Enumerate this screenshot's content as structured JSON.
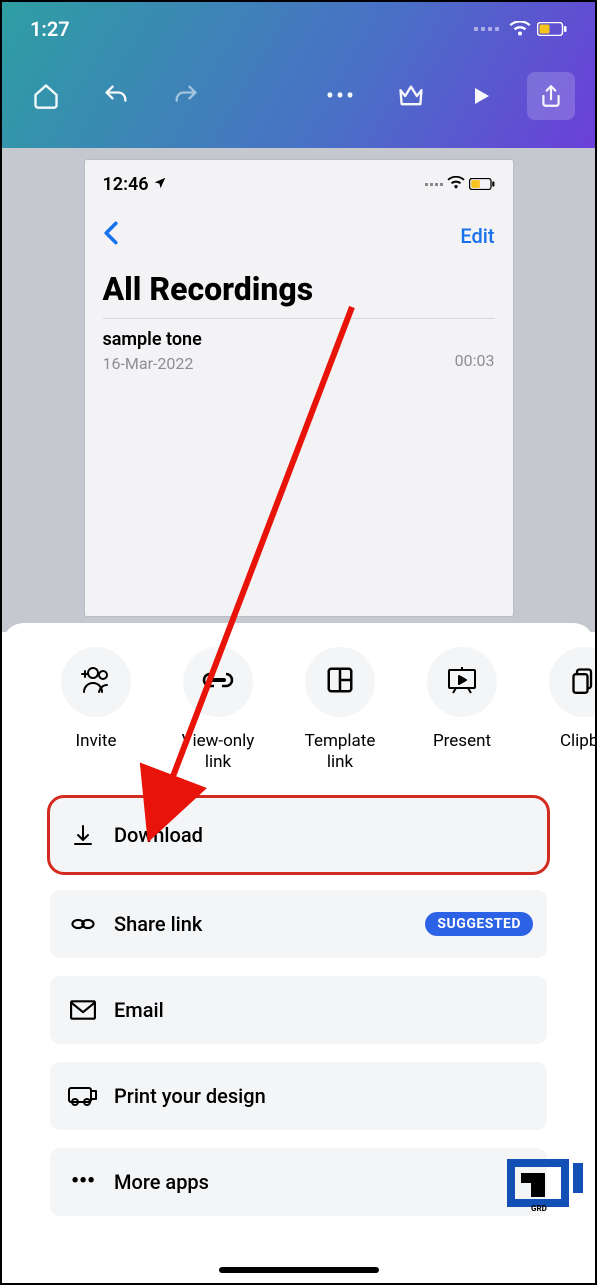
{
  "status": {
    "time": "1:27"
  },
  "inner": {
    "time": "12:46",
    "edit_label": "Edit",
    "title": "All Recordings",
    "item_name": "sample tone",
    "item_date": "16-Mar-2022",
    "item_duration": "00:03"
  },
  "share_top": {
    "items": [
      {
        "key": "invite",
        "label": "Invite"
      },
      {
        "key": "view-only-link",
        "label": "View-only link"
      },
      {
        "key": "template-link",
        "label": "Template link"
      },
      {
        "key": "present",
        "label": "Present"
      },
      {
        "key": "clipboard",
        "label": "Clipbo"
      }
    ]
  },
  "share_rows": {
    "download": "Download",
    "share_link": "Share link",
    "suggested_badge": "SUGGESTED",
    "email": "Email",
    "print": "Print your design",
    "more": "More apps"
  }
}
